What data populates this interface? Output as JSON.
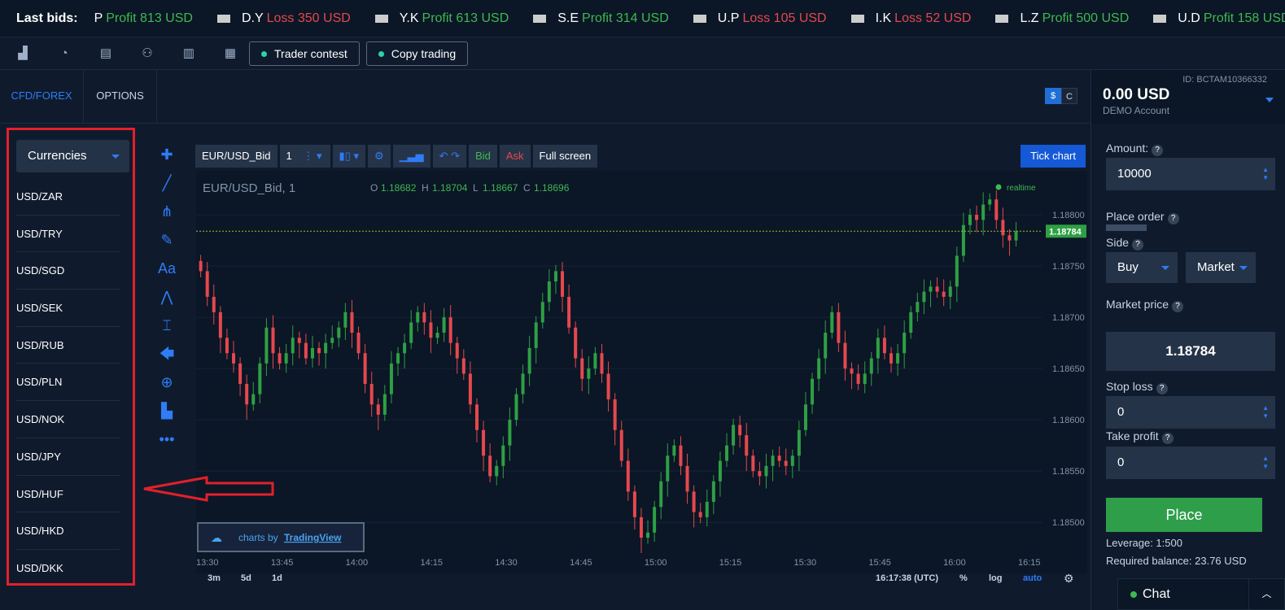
{
  "ticker": {
    "label": "Last bids:",
    "items": [
      {
        "name": "P",
        "label": "Profit 813 USD",
        "kind": "profit"
      },
      {
        "name": "D.Y",
        "label": "Loss 350 USD",
        "kind": "loss"
      },
      {
        "name": "Y.K",
        "label": "Profit 613 USD",
        "kind": "profit"
      },
      {
        "name": "S.E",
        "label": "Profit 314 USD",
        "kind": "profit"
      },
      {
        "name": "U.P",
        "label": "Loss 105 USD",
        "kind": "loss"
      },
      {
        "name": "I.K",
        "label": "Loss 52 USD",
        "kind": "loss"
      },
      {
        "name": "L.Z",
        "label": "Profit 500 USD",
        "kind": "profit"
      },
      {
        "name": "U.D",
        "label": "Profit 158 USD",
        "kind": "profit"
      }
    ]
  },
  "toolbar": {
    "trader_contest": "Trader contest",
    "copy_trading": "Copy trading"
  },
  "tabs": {
    "cfd": "CFD/FOREX",
    "options": "OPTIONS"
  },
  "currency_toggle": {
    "dollar": "$",
    "c": "C"
  },
  "account": {
    "id": "ID: BCTAM10366332",
    "balance": "0.00 USD",
    "type": "DEMO Account"
  },
  "sidebar": {
    "category": "Currencies",
    "pairs": [
      "USD/ZAR",
      "USD/TRY",
      "USD/SGD",
      "USD/SEK",
      "USD/RUB",
      "USD/PLN",
      "USD/NOK",
      "USD/JPY",
      "USD/HUF",
      "USD/HKD",
      "USD/DKK"
    ]
  },
  "chart_toolbar": {
    "symbol": "EUR/USD_Bid",
    "interval": "1",
    "bid": "Bid",
    "ask": "Ask",
    "fullscreen": "Full screen",
    "tick_chart": "Tick chart"
  },
  "chart_legend": {
    "symbol": "EUR/USD_Bid, 1",
    "o_label": "O",
    "o": "1.18682",
    "h_label": "H",
    "h": "1.18704",
    "l_label": "L",
    "l": "1.18667",
    "c_label": "C",
    "c": "1.18696",
    "realtime": "realtime",
    "current": "1.18784"
  },
  "chart_watermark": {
    "prefix": "charts by",
    "brand": "TradingView"
  },
  "chart_bottom": {
    "ranges": [
      "3m",
      "5d",
      "1d"
    ],
    "time": "16:17:38 (UTC)",
    "pct": "%",
    "log": "log",
    "auto": "auto"
  },
  "chart_data": {
    "type": "candlestick",
    "x_ticks": [
      "13:30",
      "13:45",
      "14:00",
      "14:15",
      "14:30",
      "14:45",
      "15:00",
      "15:15",
      "15:30",
      "15:45",
      "16:00",
      "16:15"
    ],
    "y_ticks": [
      "1.18800",
      "1.18750",
      "1.18700",
      "1.18650",
      "1.18600",
      "1.18550",
      "1.18500"
    ],
    "ylim": [
      1.1847,
      1.18835
    ],
    "closes": [
      1.18745,
      1.1872,
      1.18705,
      1.1868,
      1.18665,
      1.18655,
      1.18635,
      1.18615,
      1.18625,
      1.18655,
      1.1869,
      1.18665,
      1.18655,
      1.18665,
      1.1868,
      1.18675,
      1.1866,
      1.1867,
      1.18665,
      1.18675,
      1.1868,
      1.1869,
      1.18705,
      1.18685,
      1.18665,
      1.18635,
      1.18615,
      1.18605,
      1.18625,
      1.18655,
      1.18665,
      1.18675,
      1.18695,
      1.18705,
      1.18695,
      1.1868,
      1.18685,
      1.187,
      1.18675,
      1.1866,
      1.18645,
      1.18615,
      1.1859,
      1.18565,
      1.18545,
      1.18555,
      1.18575,
      1.186,
      1.18625,
      1.18645,
      1.1867,
      1.18695,
      1.18715,
      1.18735,
      1.18745,
      1.1872,
      1.1869,
      1.1866,
      1.1864,
      1.1865,
      1.18665,
      1.18645,
      1.1862,
      1.1859,
      1.1856,
      1.1853,
      1.18505,
      1.18485,
      1.1849,
      1.18515,
      1.1854,
      1.18565,
      1.18575,
      1.18555,
      1.1853,
      1.1851,
      1.18505,
      1.1852,
      1.1854,
      1.1856,
      1.18575,
      1.18595,
      1.18585,
      1.18565,
      1.1855,
      1.18545,
      1.18555,
      1.18565,
      1.1856,
      1.18555,
      1.18565,
      1.1859,
      1.18615,
      1.1864,
      1.1866,
      1.18685,
      1.18705,
      1.18675,
      1.1865,
      1.18645,
      1.18635,
      1.18645,
      1.1866,
      1.1868,
      1.18665,
      1.18655,
      1.18665,
      1.18685,
      1.18705,
      1.18715,
      1.18725,
      1.1873,
      1.18725,
      1.1872,
      1.1873,
      1.1876,
      1.1879,
      1.188,
      1.18795,
      1.1881,
      1.18815,
      1.18795,
      1.1878,
      1.18775,
      1.18784
    ]
  },
  "order": {
    "amount_label": "Amount:",
    "amount": "10000",
    "place_order_label": "Place order",
    "side_label": "Side",
    "side": "Buy",
    "type": "Market",
    "market_price_label": "Market price",
    "market_price": "1.18784",
    "stop_loss_label": "Stop loss",
    "stop_loss": "0",
    "take_profit_label": "Take profit",
    "take_profit": "0",
    "place": "Place",
    "leverage": "Leverage: 1:500",
    "required_balance": "Required balance: 23.76 USD"
  },
  "chat": {
    "label": "Chat"
  },
  "colors": {
    "up": "#2ea043",
    "down": "#e5484d",
    "accent": "#2f7cf6",
    "annotation": "#e3202a"
  }
}
